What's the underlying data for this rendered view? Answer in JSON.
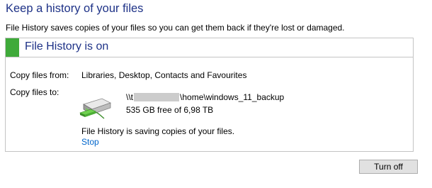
{
  "page": {
    "title": "Keep a history of your files",
    "description": "File History saves copies of your files so you can get them back if they're lost or damaged."
  },
  "status": {
    "title": "File History is on",
    "accent_color": "#3faa3a",
    "copy_from_label": "Copy files from:",
    "copy_from_value": "Libraries, Desktop, Contacts and Favourites",
    "copy_to_label": "Copy files to:",
    "drive": {
      "icon": "external-drive-icon",
      "path_prefix": "\\\\t",
      "path_suffix": "\\home\\windows_11_backup",
      "free_space": "535 GB free of 6,98 TB"
    },
    "saving_text": "File History is saving copies of your files.",
    "stop_label": "Stop"
  },
  "actions": {
    "turn_off_label": "Turn off"
  }
}
